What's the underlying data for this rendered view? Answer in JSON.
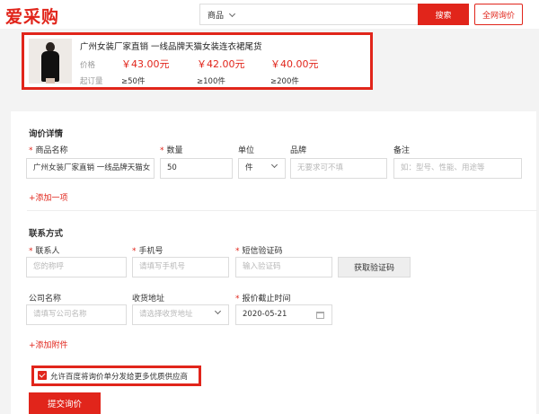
{
  "header": {
    "logo": "爱采购",
    "search_category": "商品",
    "search_button": "搜索",
    "all_inquiry_button": "全网询价"
  },
  "product": {
    "title": "广州女装厂家直销 一线品牌天猫女装连衣裙尾货",
    "price_label": "价格",
    "moq_label": "起订量",
    "prices": [
      "￥43.00元",
      "￥42.00元",
      "￥40.00元"
    ],
    "quantities": [
      "≥50件",
      "≥100件",
      "≥200件"
    ]
  },
  "inquiry": {
    "section_title": "询价详情",
    "labels": {
      "product_name": "商品名称",
      "quantity": "数量",
      "unit": "单位",
      "brand": "品牌",
      "remark": "备注"
    },
    "values": {
      "product_name": "广州女装厂家直销 一线品牌天猫女",
      "quantity": "50",
      "unit": "件"
    },
    "placeholders": {
      "brand": "无要求可不填",
      "remark": "如：型号、性能、用途等"
    },
    "add_item": "+添加一项"
  },
  "contact": {
    "section_title": "联系方式",
    "labels": {
      "contact_person": "联系人",
      "phone": "手机号",
      "sms_code": "短信验证码",
      "company": "公司名称",
      "address": "收货地址",
      "deadline": "报价截止时间"
    },
    "placeholders": {
      "contact_person": "您的称呼",
      "phone": "请填写手机号",
      "sms_code": "输入验证码",
      "company": "请填写公司名称",
      "address": "请选择收货地址"
    },
    "values": {
      "deadline": "2020-05-21"
    },
    "get_code_button": "获取验证码",
    "add_attachment": "+添加附件"
  },
  "agreement": {
    "checked": true,
    "text": "允许百度将询价单分发给更多优质供应商"
  },
  "submit_button": "提交询价",
  "colors": {
    "brand_red": "#e1251b",
    "placeholder": "#b8b8b8",
    "page_bg": "#f3f3f3"
  }
}
